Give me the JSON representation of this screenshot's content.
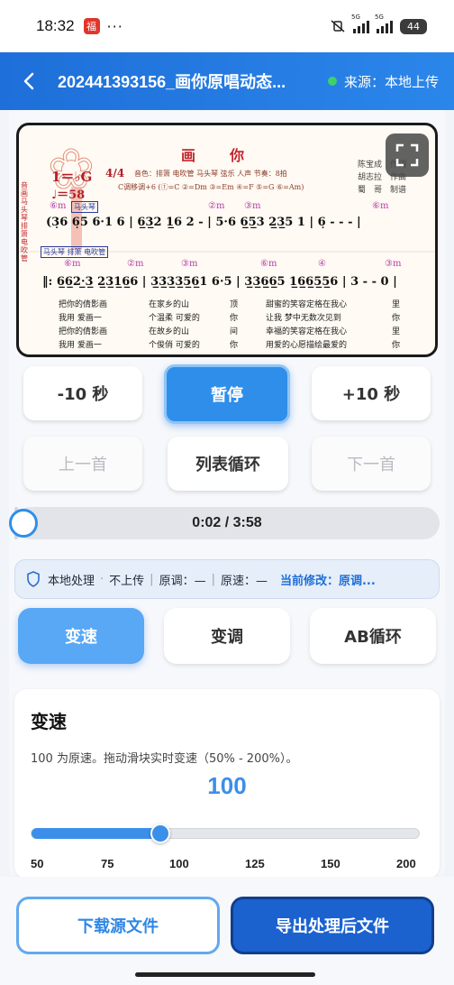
{
  "status": {
    "time": "18:32",
    "dots": "···",
    "battery": "44",
    "sim_label": "5G"
  },
  "header": {
    "title": "202441393156_画你原唱动态...",
    "source": "来源：本地上传"
  },
  "score": {
    "title": "画　　你",
    "key": "1＝♭G",
    "meter": "4/4",
    "tempo": "♩＝58",
    "credits_1": "陈宝成　作词",
    "credits_2": "胡志拉　作曲",
    "credits_3": "蜀　哥　制谱",
    "instrument_note": "音色：排箫 电吹管 马头琴 弦乐 人声 节奏：8拍",
    "fingering_note": "C调移调+6 (①=C ②=Dm ③=Em ④=F ⑤=G ⑥=Am)",
    "tag_1": "马头琴",
    "tag_2": "马头琴 排箫 电吹管",
    "line1_notes": "(3̣6 6̣5 6·1 6 | 6̲3̲2 1̲6 2 - | 5·6 6̲5̲3 2̲3̲5 1 | 6̣ - - - |",
    "line2_notes": "‖: 6̲6̲2·̲3̲ 2̲3̲1̲6̲6 | 3̲3̲3̲3̲5̲6̲1 6·5 | 3̲3̲6̲6̲5 1̲6̲6̲5̲5̲6 | 3 - - 0 |",
    "chord_marks": [
      "⑥m",
      "②m",
      "③m",
      "⑥m",
      "④",
      "③m"
    ],
    "lyrics": [
      [
        "把你的倩影画",
        "在家乡的山",
        "顶",
        "甜蜜的笑容定格在我心",
        "里"
      ],
      [
        "我用 爱画一",
        "个温柔 可爱的",
        "你",
        "让我 梦中无数次见到",
        "你"
      ],
      [
        "把你的倩影画",
        "在故乡的山",
        "间",
        "幸福的笑容定格在我心",
        "里"
      ],
      [
        "我用 爱画一",
        "个俊俏 可爱的",
        "你",
        "用爱的心愿描绘最爱的",
        "你"
      ]
    ],
    "side_text": "音画 马头琴 排箫 电吹管"
  },
  "controls": {
    "rewind": "-10 秒",
    "pause": "暂停",
    "forward": "+10 秒",
    "prev": "上一首",
    "loop_mode": "列表循环",
    "next": "下一首"
  },
  "progress": {
    "time": "0:02 / 3:58",
    "fraction": 0.008
  },
  "info": {
    "local": "本地处理",
    "dot": "·",
    "no_upload": "不上传",
    "sep": "|",
    "orig_key": "原调：—",
    "orig_speed": "原速：—",
    "current": "当前修改：原调..."
  },
  "tabs": {
    "speed": "变速",
    "pitch": "变调",
    "ab": "AB循环"
  },
  "speed": {
    "title": "变速",
    "desc": "100 为原速。拖动滑块实时变速（50% - 200%）。",
    "value": "100",
    "min": 50,
    "max": 200,
    "current": 100,
    "ticks": [
      "50",
      "75",
      "100",
      "125",
      "150",
      "200"
    ]
  },
  "bottom": {
    "download": "下载源文件",
    "export": "导出处理后文件"
  },
  "colors": {
    "accent": "#2f8eea",
    "header": "#1e6fd9",
    "export": "#1b62cf",
    "source_dot": "#3ed16b"
  }
}
